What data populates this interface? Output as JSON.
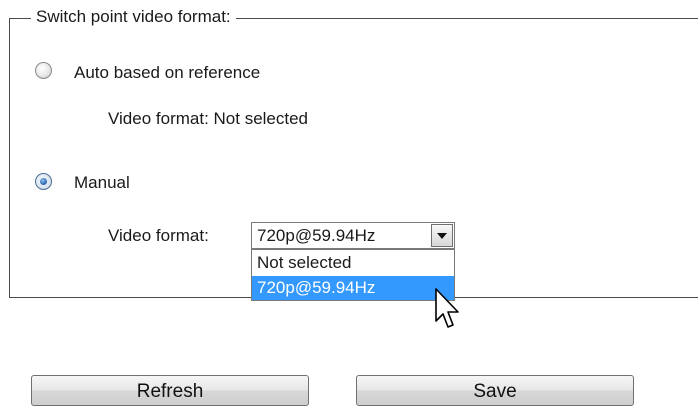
{
  "group": {
    "legend": "Switch point video format:"
  },
  "auto_option": {
    "label": "Auto based on reference",
    "checked": false,
    "video_format_text": "Video format: Not selected"
  },
  "manual_option": {
    "label": "Manual",
    "checked": true,
    "video_format_label": "Video format:"
  },
  "video_format_select": {
    "selected_value": "720p@59.94Hz",
    "options": [
      "Not selected",
      "720p@59.94Hz"
    ],
    "highlighted_index": 1
  },
  "buttons": {
    "refresh_label": "Refresh",
    "save_label": "Save"
  },
  "colors": {
    "selection_highlight": "#3399ff",
    "radio_selected": "#2f6db4"
  },
  "icons": {
    "dropdown_arrow": "chevron-down-icon",
    "cursor": "mouse-pointer-icon"
  }
}
